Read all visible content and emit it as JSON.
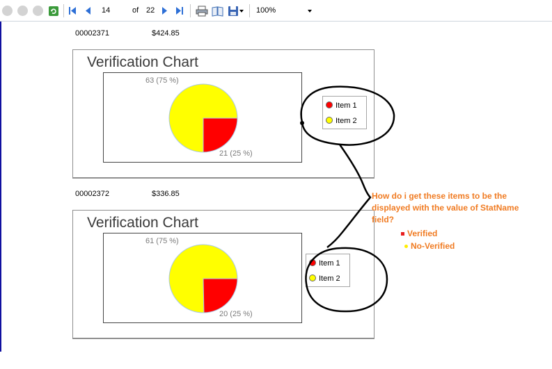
{
  "toolbar": {
    "page_current": "14",
    "of_label": "of",
    "page_total": "22",
    "zoom": "100%"
  },
  "rows": [
    {
      "id": "00002371",
      "amount": "$424.85",
      "chart_title": "Verification Chart",
      "chart_data": {
        "type": "pie",
        "title": "Verification Chart",
        "slices": [
          {
            "name": "Item 1",
            "value": 21,
            "percent": 25,
            "label": "21 (25 %)",
            "color": "#ff0000"
          },
          {
            "name": "Item 2",
            "value": 63,
            "percent": 75,
            "label": "63 (75 %)",
            "color": "#ffff00"
          }
        ],
        "legend": [
          "Item 1",
          "Item 2"
        ],
        "legend_position": "right"
      }
    },
    {
      "id": "00002372",
      "amount": "$336.85",
      "chart_title": "Verification Chart",
      "chart_data": {
        "type": "pie",
        "title": "Verification Chart",
        "slices": [
          {
            "name": "Item 1",
            "value": 20,
            "percent": 25,
            "label": "20 (25 %)",
            "color": "#ff0000"
          },
          {
            "name": "Item 2",
            "value": 61,
            "percent": 75,
            "label": "61 (75 %)",
            "color": "#ffff00"
          }
        ],
        "legend": [
          "Item 1",
          "Item 2"
        ],
        "legend_position": "right"
      }
    }
  ],
  "annotation": {
    "question": "How do i get these items to be the displayed with the value of StatName field?",
    "question_lines": [
      "How do i get these items to be the",
      "displayed with the value of StatName",
      "field?"
    ],
    "items": [
      {
        "label": "Verified",
        "color": "#e81e1e"
      },
      {
        "label": "No-Verified",
        "color": "#ffee00"
      }
    ],
    "accent_color": "#f07b22"
  }
}
